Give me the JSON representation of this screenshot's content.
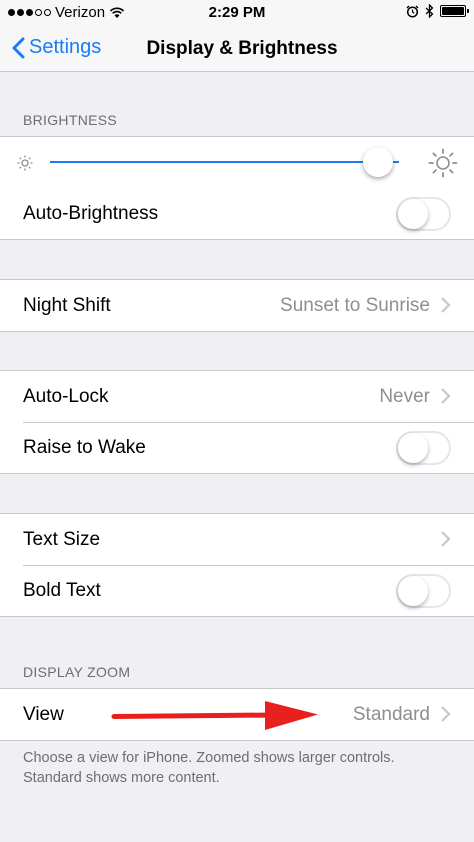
{
  "status_bar": {
    "carrier": "Verizon",
    "time": "2:29 PM",
    "signal_bars": 3,
    "battery_level": 1.0
  },
  "nav": {
    "back_label": "Settings",
    "title": "Display & Brightness"
  },
  "brightness": {
    "header": "BRIGHTNESS",
    "level": 0.94,
    "auto_brightness_label": "Auto-Brightness",
    "auto_brightness_on": false
  },
  "night_shift": {
    "label": "Night Shift",
    "value": "Sunset to Sunrise"
  },
  "lock": {
    "auto_lock_label": "Auto-Lock",
    "auto_lock_value": "Never",
    "raise_to_wake_label": "Raise to Wake",
    "raise_to_wake_on": false
  },
  "text": {
    "text_size_label": "Text Size",
    "bold_text_label": "Bold Text",
    "bold_text_on": false
  },
  "display_zoom": {
    "header": "DISPLAY ZOOM",
    "view_label": "View",
    "view_value": "Standard",
    "footer": "Choose a view for iPhone. Zoomed shows larger controls. Standard shows more content."
  },
  "colors": {
    "accent": "#1a7cf5",
    "arrow": "#e8201e",
    "background": "#efeff4",
    "secondary_text": "#8e8e93"
  },
  "icons": [
    "wifi-icon",
    "alarm-icon",
    "bluetooth-icon",
    "battery-icon",
    "chevron-left-icon",
    "sun-small-icon",
    "sun-large-icon",
    "chevron-right-icon",
    "red-arrow-annotation"
  ]
}
